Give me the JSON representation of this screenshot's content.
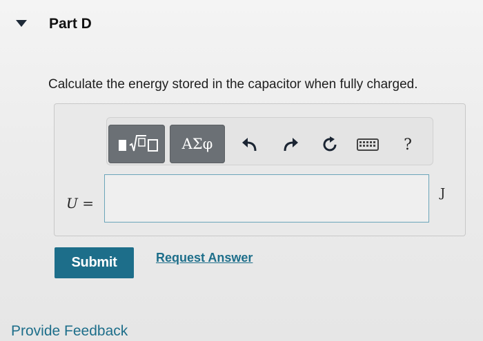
{
  "part": {
    "title": "Part D"
  },
  "question": {
    "text": "Calculate the energy stored in the capacitor when fully charged."
  },
  "toolbar": {
    "templates_icon": "templates-radical-icon",
    "symbols_label": "ΑΣφ",
    "undo_icon": "undo-icon",
    "redo_icon": "redo-icon",
    "reset_icon": "reset-icon",
    "keyboard_icon": "keyboard-icon",
    "help_label": "?"
  },
  "answer": {
    "variable": "U",
    "equals": "=",
    "value": "",
    "unit": "J"
  },
  "actions": {
    "submit_label": "Submit",
    "request_label": "Request Answer"
  },
  "footer": {
    "feedback_label": "Provide Feedback"
  },
  "colors": {
    "accent": "#1d6e8a",
    "toolbar_button": "#6b7075",
    "input_border": "#6aa4b9"
  }
}
